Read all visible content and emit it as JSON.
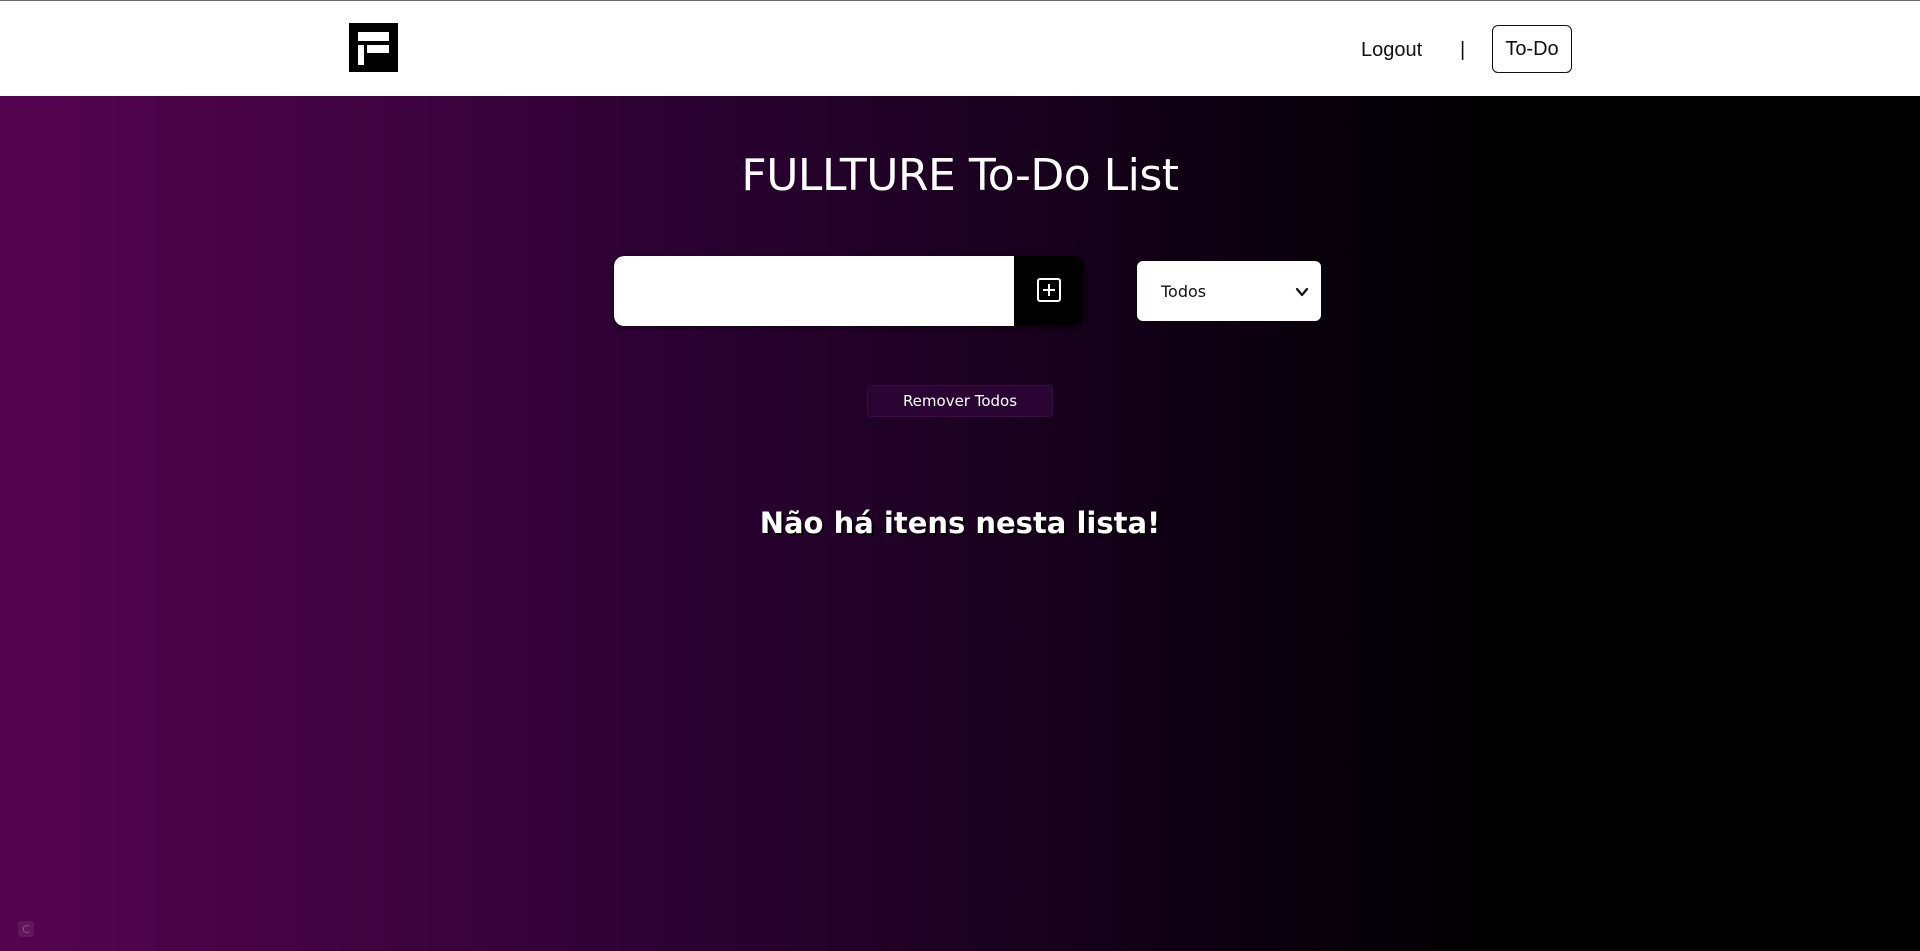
{
  "nav": {
    "logo_icon": "fullture-logo-icon",
    "logout_label": "Logout",
    "separator": "|",
    "todo_label": "To-Do"
  },
  "main": {
    "title": "FULLTURE To-Do List",
    "input": {
      "value": "",
      "placeholder": ""
    },
    "add_icon": "plus-square-icon",
    "filter": {
      "selected": "Todos",
      "icon": "chevron-down-icon"
    },
    "remove_all_label": "Remover Todos",
    "empty_message": "Não há itens nesta lista!"
  },
  "colors": {
    "gradient_start": "#560450",
    "gradient_end": "#000000",
    "remove_button_bg": "#2a0534"
  }
}
